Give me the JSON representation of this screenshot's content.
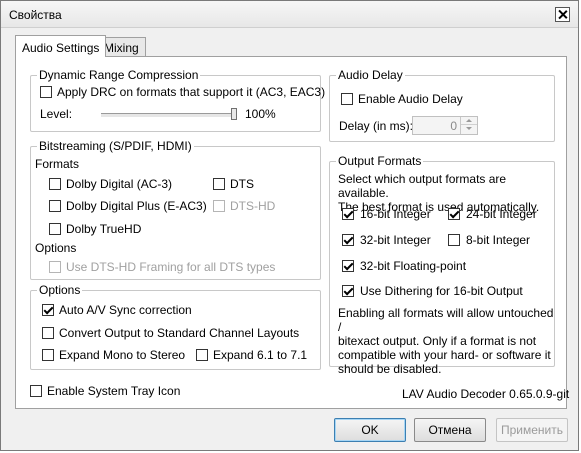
{
  "window": {
    "title": "Свойства"
  },
  "tabs": [
    {
      "label": "Audio Settings",
      "active": true
    },
    {
      "label": "Mixing",
      "active": false
    }
  ],
  "drc": {
    "title": "Dynamic Range Compression",
    "apply_label": "Apply DRC on formats that support it (AC3, EAC3)",
    "apply_checked": false,
    "level_label": "Level:",
    "level_value": "100%",
    "level_fraction": 1.0
  },
  "bitstreaming": {
    "title": "Bitstreaming (S/PDIF, HDMI)",
    "formats_label": "Formats",
    "items": [
      {
        "label": "Dolby Digital (AC-3)",
        "checked": false,
        "enabled": true
      },
      {
        "label": "DTS",
        "checked": false,
        "enabled": true
      },
      {
        "label": "Dolby Digital Plus (E-AC3)",
        "checked": false,
        "enabled": true
      },
      {
        "label": "DTS-HD",
        "checked": false,
        "enabled": false
      },
      {
        "label": "Dolby TrueHD",
        "checked": false,
        "enabled": true
      }
    ],
    "options_label": "Options",
    "dtshd_framing_label": "Use DTS-HD Framing for all DTS types",
    "dtshd_framing_enabled": false
  },
  "options": {
    "title": "Options",
    "items": [
      {
        "label": "Auto A/V Sync correction",
        "checked": true
      },
      {
        "label": "Convert Output to Standard Channel Layouts",
        "checked": false
      },
      {
        "label": "Expand Mono to Stereo",
        "checked": false
      },
      {
        "label": "Expand 6.1 to 7.1",
        "checked": false
      }
    ]
  },
  "system_tray": {
    "label": "Enable System Tray Icon",
    "checked": false
  },
  "audio_delay": {
    "title": "Audio Delay",
    "enable_label": "Enable Audio Delay",
    "enable_checked": false,
    "delay_label": "Delay (in ms):",
    "delay_value": "0"
  },
  "output_formats": {
    "title": "Output Formats",
    "description": [
      "Select which output formats are available.",
      "The best format is used automatically."
    ],
    "items": [
      {
        "label": "16-bit Integer",
        "checked": true
      },
      {
        "label": "24-bit Integer",
        "checked": true
      },
      {
        "label": "32-bit Integer",
        "checked": true
      },
      {
        "label": "8-bit Integer",
        "checked": false
      },
      {
        "label": "32-bit Floating-point",
        "checked": true
      },
      {
        "label": "Use Dithering for 16-bit Output",
        "checked": true
      }
    ],
    "note": [
      "Enabling all formats will allow untouched /",
      "bitexact output. Only if a format is not",
      "compatible with your hard- or software it",
      "should be disabled."
    ]
  },
  "version": "LAV Audio Decoder 0.65.0.9-git",
  "buttons": {
    "ok": "OK",
    "cancel": "Отмена",
    "apply": "Применить"
  }
}
